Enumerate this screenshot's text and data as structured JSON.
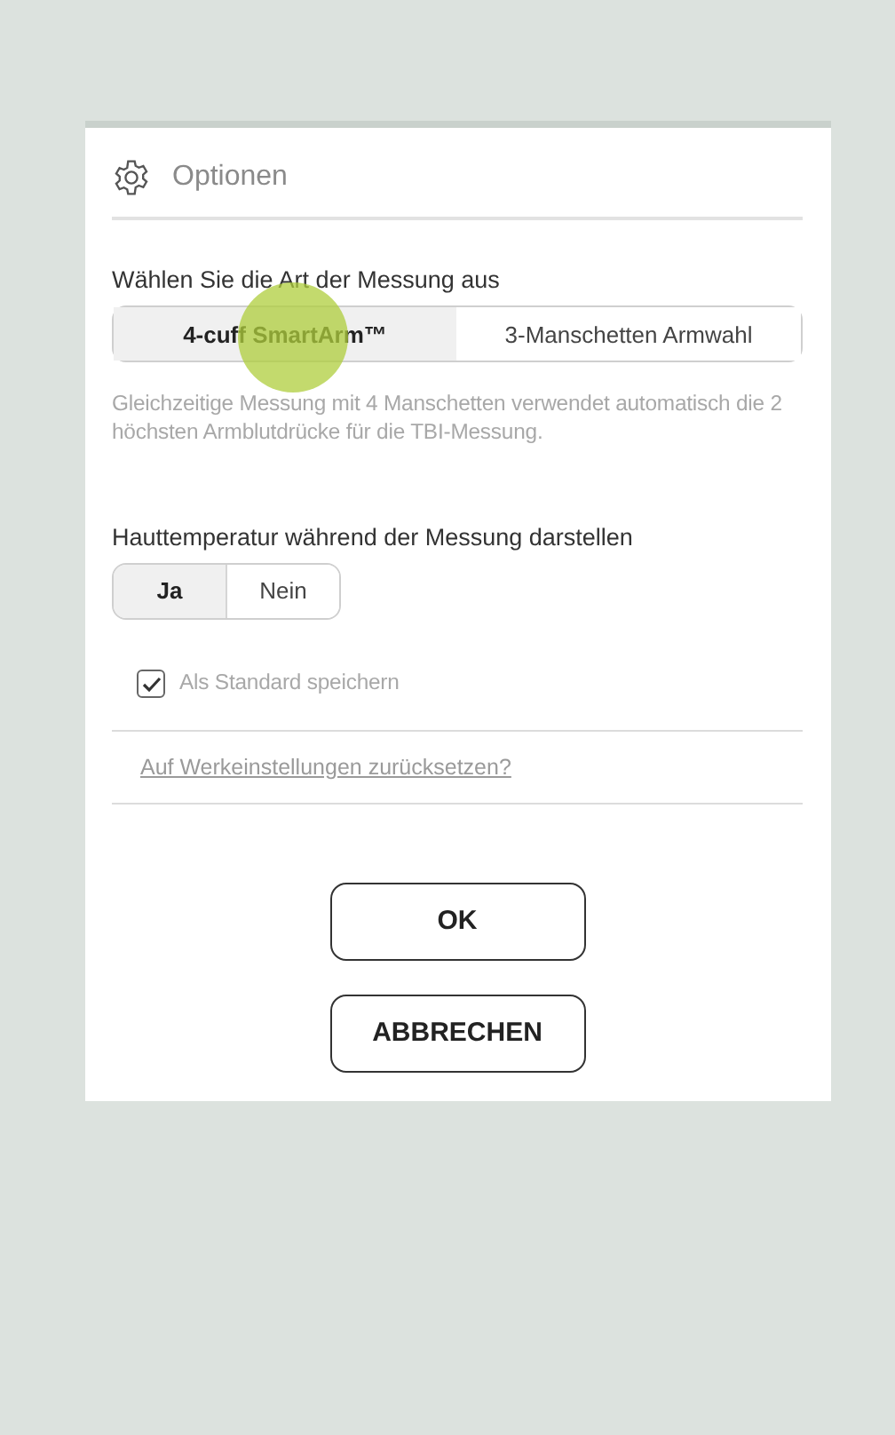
{
  "dialog": {
    "title": "Optionen"
  },
  "measurement": {
    "label": "Wählen Sie die Art der Messung aus",
    "options": [
      {
        "label": "4-cuff SmartArm™",
        "selected": true,
        "touched": true
      },
      {
        "label": "3-Manschetten Armwahl",
        "selected": false,
        "touched": false
      }
    ],
    "help": "Gleichzeitige Messung mit 4 Manschetten verwendet automatisch die 2 höchsten Armblutdrücke für die TBI-Messung."
  },
  "skin_temperature": {
    "label": "Hauttemperatur während der Messung darstellen",
    "options": [
      {
        "label": "Ja",
        "selected": true
      },
      {
        "label": "Nein",
        "selected": false
      }
    ]
  },
  "save_default": {
    "label": "Als Standard speichern",
    "checked": true
  },
  "reset_link": "Auf Werkeinstellungen zurücksetzen?",
  "buttons": [
    "OK",
    "ABBRECHEN"
  ]
}
